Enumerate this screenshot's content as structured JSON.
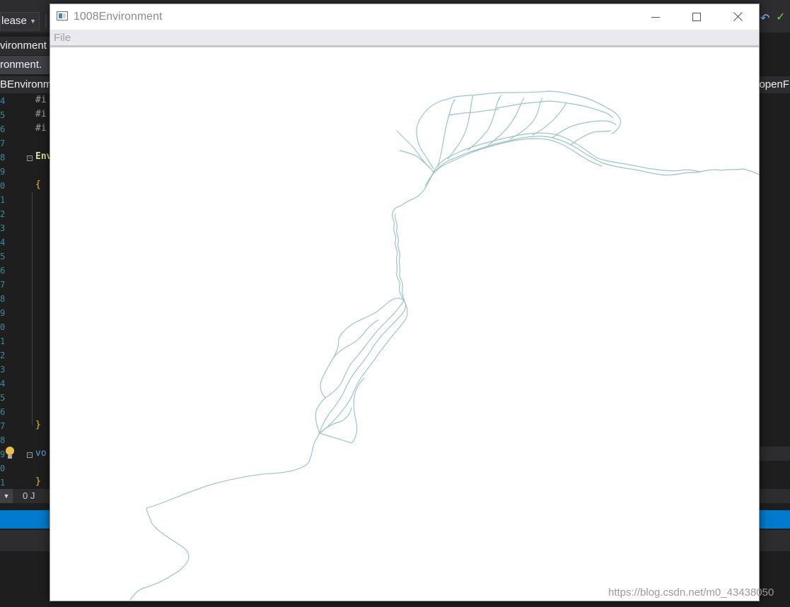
{
  "ide": {
    "config_label": "lease",
    "tab1": "vironment",
    "tab2": "ronment.",
    "nav_left": "BEnvironm",
    "nav_right": "openF",
    "bottom_text": "0 J",
    "code": {
      "include1": "#i",
      "include2": "#i",
      "include3": "#i",
      "env": "Env",
      "brace_open": "{",
      "brace_close": "}",
      "void": "vo",
      "brace_close2": "}"
    },
    "line_numbers": [
      "4",
      "5",
      "6",
      "7",
      "8",
      "9",
      "0",
      "1",
      "2",
      "3",
      "4",
      "5",
      "6",
      "7",
      "8",
      "9",
      "0",
      "1",
      "2",
      "3",
      "4",
      "5",
      "6",
      "7",
      "8",
      "9",
      "0",
      "1"
    ]
  },
  "window": {
    "title": "1008Environment",
    "menu": {
      "file": "File"
    },
    "icons": {
      "app": "app-window-icon",
      "minimize": "minimize-icon",
      "maximize": "maximize-icon",
      "close": "close-icon"
    },
    "river_color": "#9cc4c8"
  },
  "watermark": "https://blog.csdn.net/m0_43438050"
}
